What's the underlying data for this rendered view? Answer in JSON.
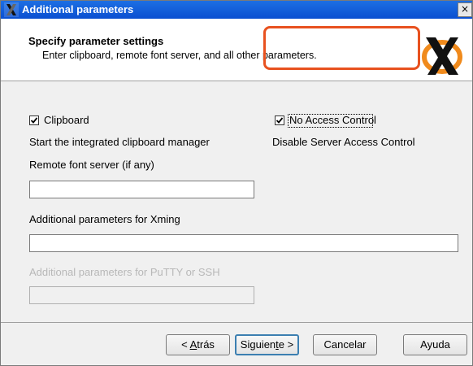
{
  "window": {
    "title": "Additional parameters",
    "close_glyph": "×"
  },
  "header": {
    "title": "Specify parameter settings",
    "subtitle": "Enter clipboard, remote font server, and all other parameters."
  },
  "options": {
    "clipboard": {
      "label": "Clipboard",
      "checked": true,
      "description": "Start the integrated clipboard manager"
    },
    "no_access_control": {
      "label": "No Access Control",
      "checked": true,
      "description": "Disable Server Access Control"
    }
  },
  "fields": {
    "font_server": {
      "label": "Remote font server (if any)",
      "value": ""
    },
    "xming_params": {
      "label": "Additional parameters for Xming",
      "value": ""
    },
    "putty_params": {
      "label": "Additional parameters for PuTTY or SSH",
      "value": "",
      "enabled": false
    }
  },
  "buttons": {
    "back": {
      "pre": "< ",
      "accel": "A",
      "post": "trás"
    },
    "next": {
      "pre": "Siguien",
      "accel": "t",
      "post": "e >"
    },
    "cancel": {
      "label": "Cancelar"
    },
    "help": {
      "label": "Ayuda"
    }
  },
  "colors": {
    "titlebar": "#0a4fd1",
    "highlight": "#e8511f",
    "logo_orange": "#f08a1c"
  },
  "icons": {
    "title": "xming-logo-icon",
    "header": "xming-logo-icon",
    "check": "checkmark-icon",
    "close": "close-icon"
  }
}
